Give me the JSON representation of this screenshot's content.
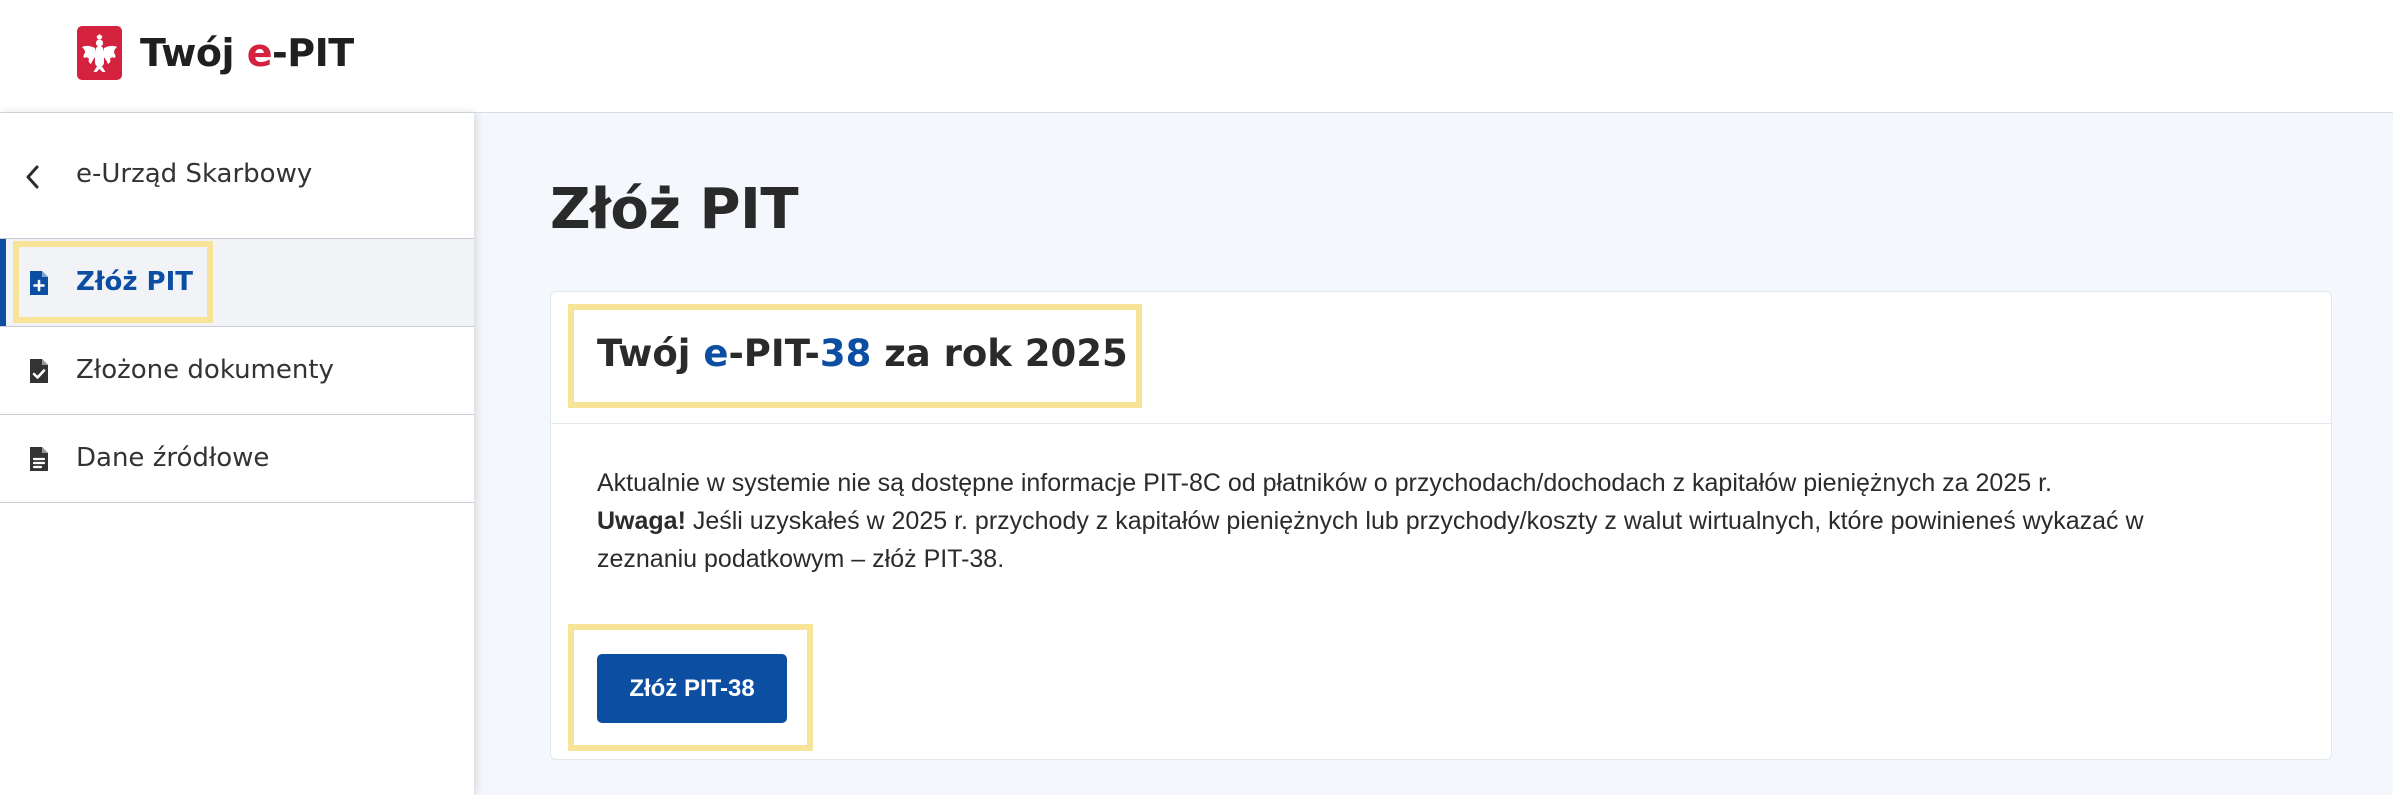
{
  "header": {
    "logo_icon": "polish-eagle-emblem-icon",
    "brand_prefix": "Twój ",
    "brand_accent": "e",
    "brand_suffix": "-PIT",
    "accent_color": "#d4213d"
  },
  "sidebar": {
    "back": {
      "icon": "chevron-left-icon",
      "label": "e-Urząd Skarbowy"
    },
    "items": [
      {
        "icon": "file-plus-icon",
        "label": "Złóż PIT",
        "active": true
      },
      {
        "icon": "file-check-icon",
        "label": "Złożone dokumenty",
        "active": false
      },
      {
        "icon": "file-text-icon",
        "label": "Dane źródłowe",
        "active": false
      }
    ],
    "active_color": "#0b4ea2"
  },
  "main": {
    "title": "Złóż PIT",
    "card": {
      "title_prefix": "Twój ",
      "title_blue_1": "e",
      "title_mid": "-PIT-",
      "title_blue_2": "38",
      "title_suffix": " za rok 2025",
      "info_line": "Aktualnie w systemie nie są dostępne informacje PIT-8C od płatników o przychodach/dochodach z kapitałów pieniężnych za 2025 r.",
      "warning_label": "Uwaga!",
      "warning_text": " Jeśli uzyskałeś w 2025 r. przychody z kapitałów pieniężnych lub przychody/koszty z walut wirtualnych, które powinieneś wykazać w zeznaniu podatkowym – złóż PIT-38.",
      "button_label": "Złóż PIT-38"
    }
  },
  "colors": {
    "primary": "#0b4ea2",
    "highlight": "#f7e499",
    "page_background": "#f4f7fb"
  }
}
